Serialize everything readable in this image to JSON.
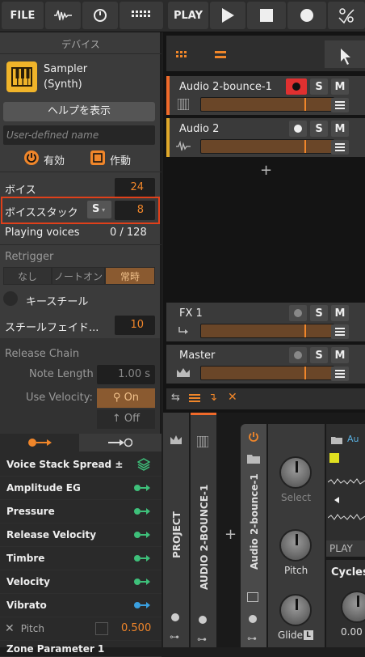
{
  "toolbar": {
    "file_label": "FILE",
    "play_label": "PLAY"
  },
  "inspector": {
    "section_title": "デバイス",
    "device_name": "Sampler",
    "device_type": "(Synth)",
    "help_label": "ヘルプを表示",
    "name_placeholder": "User-defined name",
    "enabled_label": "有効",
    "active_label": "作動",
    "voices_label": "ボイス",
    "voices_value": "24",
    "voice_stack_label": "ボイススタック",
    "voice_stack_mode": "S",
    "voice_stack_value": "8",
    "playing_voices_label": "Playing voices",
    "playing_voices_value": "0 / 128",
    "retrigger_label": "Retrigger",
    "retrigger_options": [
      "なし",
      "ノートオン",
      "常時"
    ],
    "keysteal_label": "キースチール",
    "steal_fade_label": "スチールフェイド...",
    "steal_fade_value": "10",
    "release_chain_label": "Release Chain",
    "note_length_label": "Note Length",
    "note_length_value": "1.00 s",
    "use_velocity_label": "Use Velocity:",
    "on_label": "On",
    "off_label": "Off"
  },
  "modulation": {
    "items": [
      "Voice Stack Spread ±",
      "Amplitude EG",
      "Pressure",
      "Release Velocity",
      "Timbre",
      "Velocity",
      "Vibrato"
    ],
    "pitch_label": "Pitch",
    "pitch_value": "0.500",
    "partial_item": "Zone Parameter 1"
  },
  "tracks": [
    {
      "name": "Audio 2-bounce-1",
      "color": "#f06a2a"
    },
    {
      "name": "Audio 2",
      "color": "#e0a82a"
    },
    {
      "name": "FX 1",
      "color": "#3a3a3a"
    },
    {
      "name": "Master",
      "color": "#3a3a3a"
    }
  ],
  "track_buttons": {
    "solo": "S",
    "mute": "M"
  },
  "device_chain": {
    "project_label": "PROJECT",
    "bounce_label": "AUDIO 2-BOUNCE-1",
    "device_title": "Audio 2-bounce-1",
    "select_label": "Select",
    "pitch_label": "Pitch",
    "glide_label": "Glide",
    "play_label": "PLAY",
    "cycles_label": "Cycles",
    "au_label": "Au",
    "value_label": "0.00"
  },
  "colors": {
    "accent": "#f0862a",
    "highlight": "#e0401a",
    "green": "#3ec07a",
    "blue": "#3aa0e0"
  }
}
